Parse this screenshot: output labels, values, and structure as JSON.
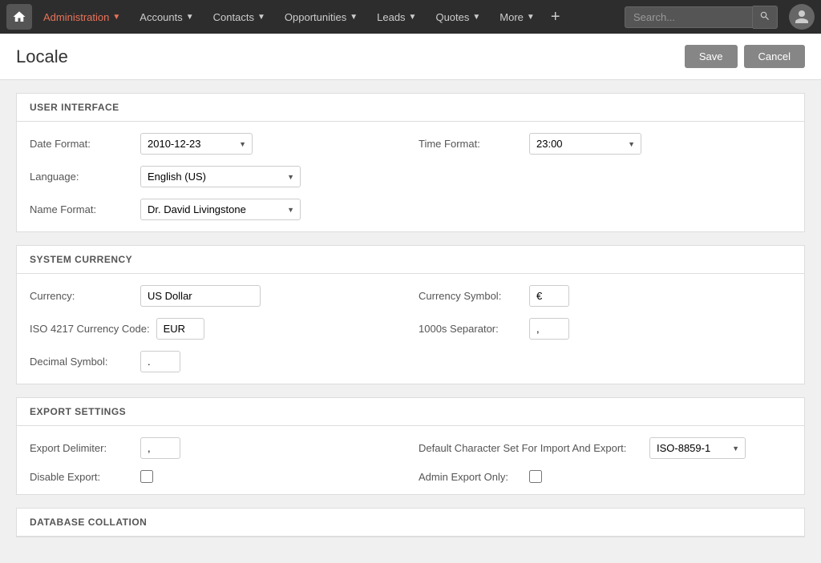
{
  "navbar": {
    "home_label": "Home",
    "items": [
      {
        "label": "Administration",
        "active": true
      },
      {
        "label": "Accounts"
      },
      {
        "label": "Contacts"
      },
      {
        "label": "Opportunities"
      },
      {
        "label": "Leads"
      },
      {
        "label": "Quotes"
      },
      {
        "label": "More"
      }
    ],
    "search_placeholder": "Search...",
    "plus_label": "+"
  },
  "page": {
    "title": "Locale",
    "save_label": "Save",
    "cancel_label": "Cancel"
  },
  "sections": {
    "user_interface": {
      "header": "USER INTERFACE",
      "date_format_label": "Date Format:",
      "date_format_value": "2010-12-23",
      "time_format_label": "Time Format:",
      "time_format_value": "23:00",
      "language_label": "Language:",
      "language_value": "English (US)",
      "name_format_label": "Name Format:",
      "name_format_value": "Dr. David Livingstone"
    },
    "system_currency": {
      "header": "SYSTEM CURRENCY",
      "currency_label": "Currency:",
      "currency_value": "US Dollar",
      "currency_symbol_label": "Currency Symbol:",
      "currency_symbol_value": "€",
      "iso_label": "ISO 4217 Currency Code:",
      "iso_value": "EUR",
      "thousands_separator_label": "1000s Separator:",
      "thousands_separator_value": ",",
      "decimal_symbol_label": "Decimal Symbol:",
      "decimal_symbol_value": "."
    },
    "export_settings": {
      "header": "EXPORT SETTINGS",
      "export_delimiter_label": "Export Delimiter:",
      "export_delimiter_value": ",",
      "default_charset_label": "Default Character Set For Import And Export:",
      "default_charset_value": "ISO-8859-1",
      "disable_export_label": "Disable Export:",
      "admin_export_label": "Admin Export Only:"
    },
    "database_collation": {
      "header": "DATABASE COLLATION"
    }
  }
}
